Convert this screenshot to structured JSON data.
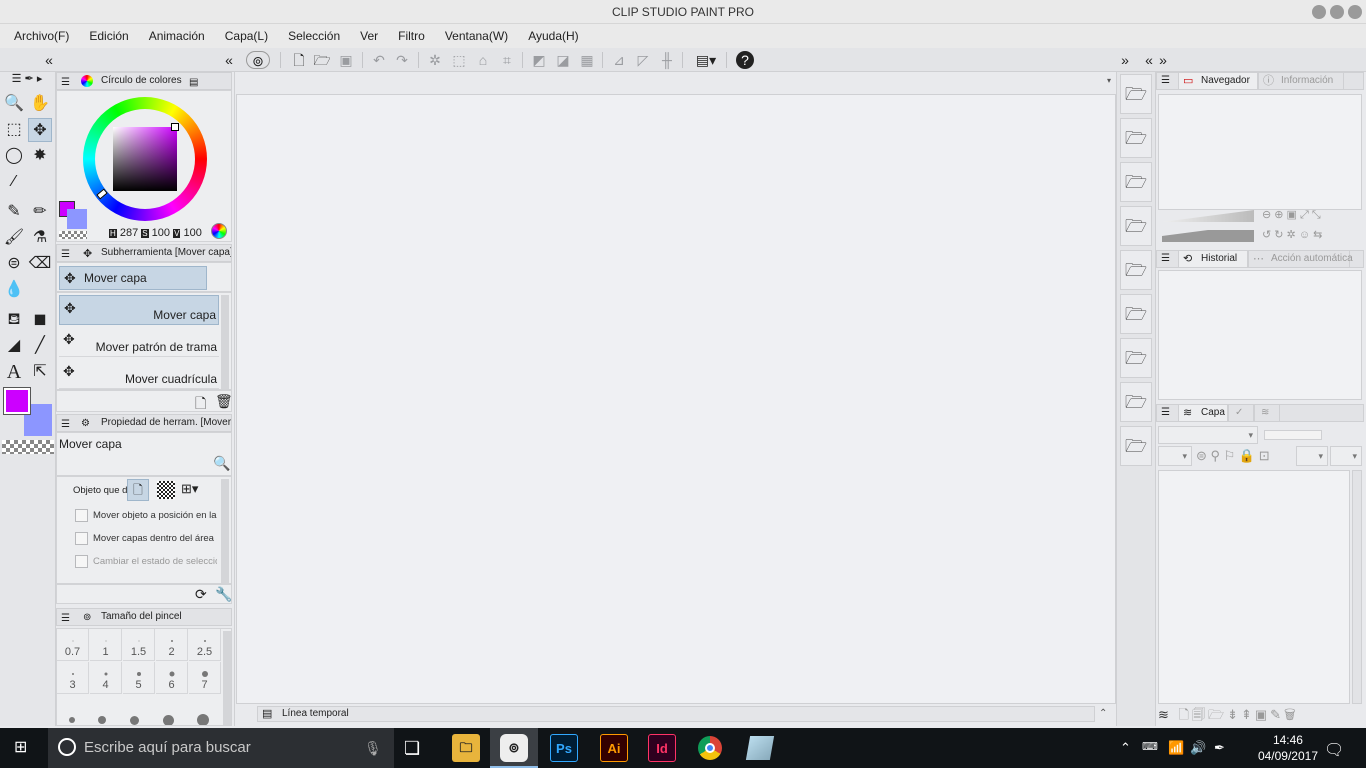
{
  "app": {
    "title": "CLIP STUDIO PAINT PRO"
  },
  "menu": [
    "Archivo(F)",
    "Edición",
    "Animación",
    "Capa(L)",
    "Selección",
    "Ver",
    "Filtro",
    "Ventana(W)",
    "Ayuda(H)"
  ],
  "colors": {
    "main": "#cc00ff",
    "sub": "#8c96ff",
    "accent": "#c7d6e4"
  },
  "color_wheel": {
    "title": "Círculo de colores",
    "h_label": "H",
    "h": "287",
    "s_label": "S",
    "s": "100",
    "v_label": "V",
    "v": "100"
  },
  "subtool": {
    "title": "Subherramienta [Mover capa]",
    "group": "Mover capa",
    "items": [
      "Mover capa",
      "Mover patrón de trama",
      "Mover cuadrícula"
    ]
  },
  "tool_property": {
    "title": "Propiedad de herram. [Mover",
    "name": "Mover capa",
    "target_label": "Objeto que de",
    "checks": [
      "Mover objeto a posición en la que s",
      "Mover capas dentro del área selec",
      "Cambiar el estado de selección del"
    ]
  },
  "brush_size": {
    "title": "Tamaño del pincel",
    "sizes": [
      "0.7",
      "1",
      "1.5",
      "2",
      "2.5",
      "3",
      "4",
      "5",
      "6",
      "7"
    ]
  },
  "timeline": {
    "label": "Línea temporal"
  },
  "right": {
    "navigator": "Navegador",
    "info": "Información",
    "history": "Historial",
    "auto_action": "Acción automática",
    "layer": "Capa"
  },
  "taskbar": {
    "search_placeholder": "Escribe aquí para buscar",
    "time": "14:46",
    "date": "04/09/2017",
    "apps": [
      "Ps",
      "Ai",
      "Id"
    ]
  }
}
